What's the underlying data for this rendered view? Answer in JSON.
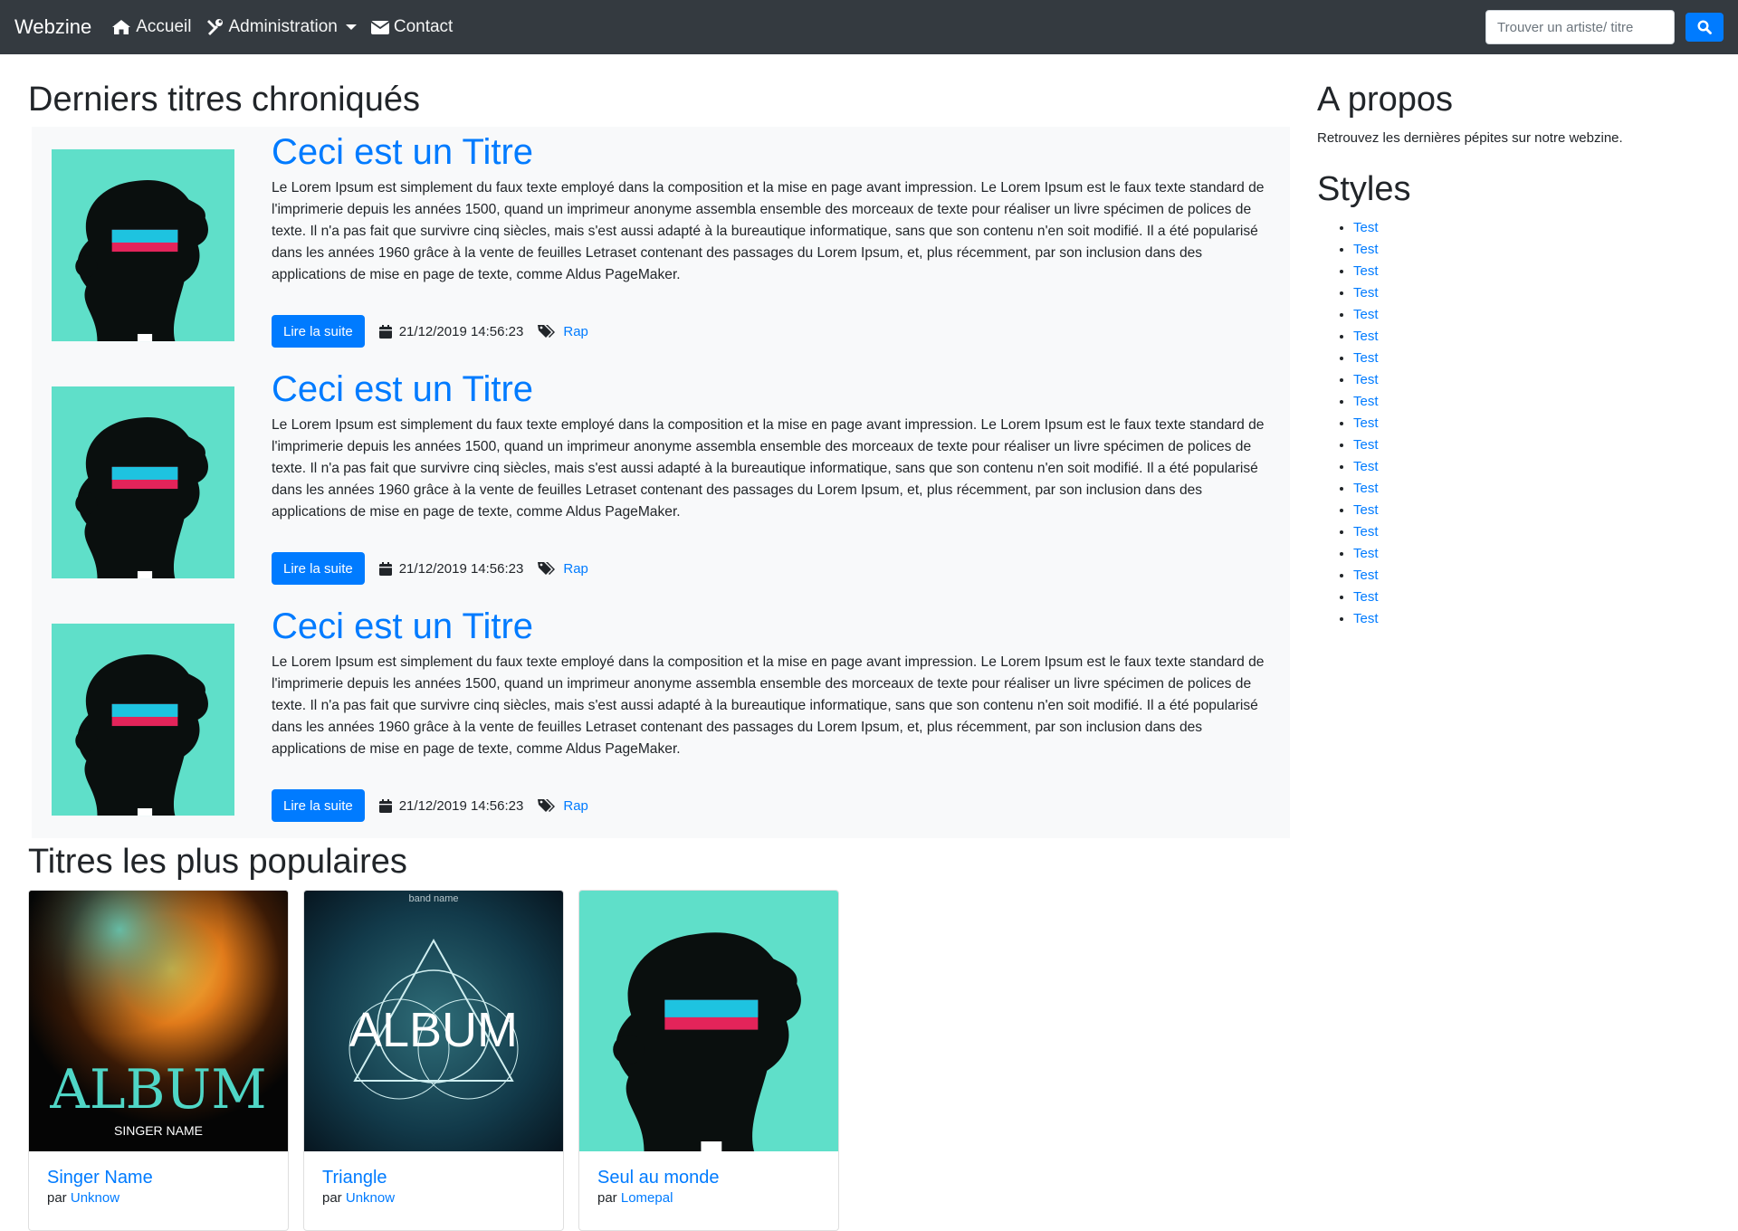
{
  "navbar": {
    "brand": "Webzine",
    "links": [
      {
        "label": "Accueil",
        "icon": "home-icon"
      },
      {
        "label": "Administration",
        "icon": "tools-icon"
      },
      {
        "label": "Contact",
        "icon": "envelope-icon"
      }
    ],
    "search_placeholder": "Trouver un artiste/ titre",
    "search_icon": "search-icon"
  },
  "latest": {
    "heading": "Derniers titres chroniqués",
    "posts": [
      {
        "title": "Ceci est un Titre",
        "excerpt": "Le Lorem Ipsum est simplement du faux texte employé dans la composition et la mise en page avant impression. Le Lorem Ipsum est le faux texte standard de l'imprimerie depuis les années 1500, quand un imprimeur anonyme assembla ensemble des morceaux de texte pour réaliser un livre spécimen de polices de texte. Il n'a pas fait que survivre cinq siècles, mais s'est aussi adapté à la bureautique informatique, sans que son contenu n'en soit modifié. Il a été popularisé dans les années 1960 grâce à la vente de feuilles Letraset contenant des passages du Lorem Ipsum, et, plus récemment, par son inclusion dans des applications de mise en page de texte, comme Aldus PageMaker.",
        "button": "Lire la suite",
        "date": "21/12/2019 14:56:23",
        "tag": "Rap"
      },
      {
        "title": "Ceci est un Titre",
        "excerpt": "Le Lorem Ipsum est simplement du faux texte employé dans la composition et la mise en page avant impression. Le Lorem Ipsum est le faux texte standard de l'imprimerie depuis les années 1500, quand un imprimeur anonyme assembla ensemble des morceaux de texte pour réaliser un livre spécimen de polices de texte. Il n'a pas fait que survivre cinq siècles, mais s'est aussi adapté à la bureautique informatique, sans que son contenu n'en soit modifié. Il a été popularisé dans les années 1960 grâce à la vente de feuilles Letraset contenant des passages du Lorem Ipsum, et, plus récemment, par son inclusion dans des applications de mise en page de texte, comme Aldus PageMaker.",
        "button": "Lire la suite",
        "date": "21/12/2019 14:56:23",
        "tag": "Rap"
      },
      {
        "title": "Ceci est un Titre",
        "excerpt": "Le Lorem Ipsum est simplement du faux texte employé dans la composition et la mise en page avant impression. Le Lorem Ipsum est le faux texte standard de l'imprimerie depuis les années 1500, quand un imprimeur anonyme assembla ensemble des morceaux de texte pour réaliser un livre spécimen de polices de texte. Il n'a pas fait que survivre cinq siècles, mais s'est aussi adapté à la bureautique informatique, sans que son contenu n'en soit modifié. Il a été popularisé dans les années 1960 grâce à la vente de feuilles Letraset contenant des passages du Lorem Ipsum, et, plus récemment, par son inclusion dans des applications de mise en page de texte, comme Aldus PageMaker.",
        "button": "Lire la suite",
        "date": "21/12/2019 14:56:23",
        "tag": "Rap"
      }
    ]
  },
  "popular": {
    "heading": "Titres les plus populaires",
    "cards": [
      {
        "title": "Singer Name",
        "by": "par",
        "artist": "Unknow",
        "cover_text": "ALBUM",
        "cover_sub": "SINGER NAME"
      },
      {
        "title": "Triangle",
        "by": "par",
        "artist": "Unknow",
        "cover_text": "ALBUM",
        "cover_sub": "band name"
      },
      {
        "title": "Seul au monde",
        "by": "par",
        "artist": "Lomepal"
      }
    ]
  },
  "sidebar": {
    "about_title": "A propos",
    "about_text": "Retrouvez les dernières pépites sur notre webzine.",
    "styles_title": "Styles",
    "styles": [
      "Test",
      "Test",
      "Test",
      "Test",
      "Test",
      "Test",
      "Test",
      "Test",
      "Test",
      "Test",
      "Test",
      "Test",
      "Test",
      "Test",
      "Test",
      "Test",
      "Test",
      "Test",
      "Test"
    ]
  },
  "colors": {
    "navbar": "#343a40",
    "primary": "#007bff",
    "panel": "#f8f9fa",
    "cover_teal": "#5fdfc9"
  }
}
